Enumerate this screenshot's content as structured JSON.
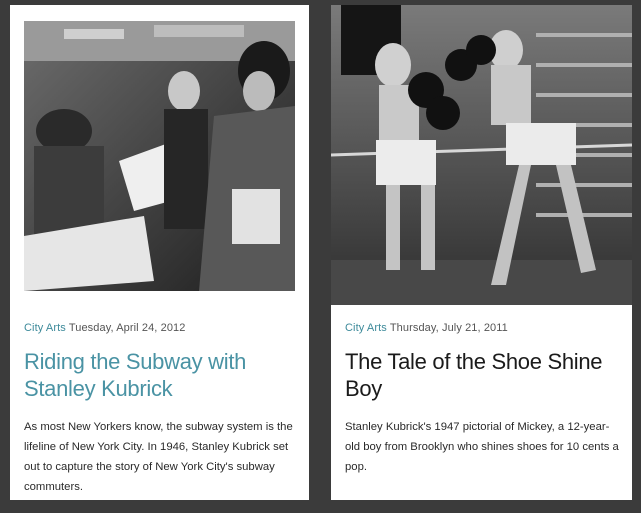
{
  "articles": [
    {
      "image_alt": "Black and white photo of subway commuters reading newspapers",
      "category": "City Arts",
      "date": "Tuesday, April 24, 2012",
      "title": "Riding the Subway with Stanley Kubrick",
      "excerpt": "As most New Yorkers know, the subway system is the lifeline of New York City. In 1946, Stanley Kubrick set out to capture the story of New York City's subway commuters."
    },
    {
      "image_alt": "Black and white photo of two boys boxing in a gym",
      "category": "City Arts",
      "date": "Thursday, July 21, 2011",
      "title": "The Tale of the Shoe Shine Boy",
      "excerpt": "Stanley Kubrick's 1947 pictorial of Mickey, a 12-year-old boy from Brooklyn who shines shoes for 10 cents a pop."
    }
  ],
  "colors": {
    "page_background": "#3b3b3b",
    "card_background": "#ffffff",
    "category_link": "#3d8a9a",
    "linked_title": "#4a93a4"
  }
}
